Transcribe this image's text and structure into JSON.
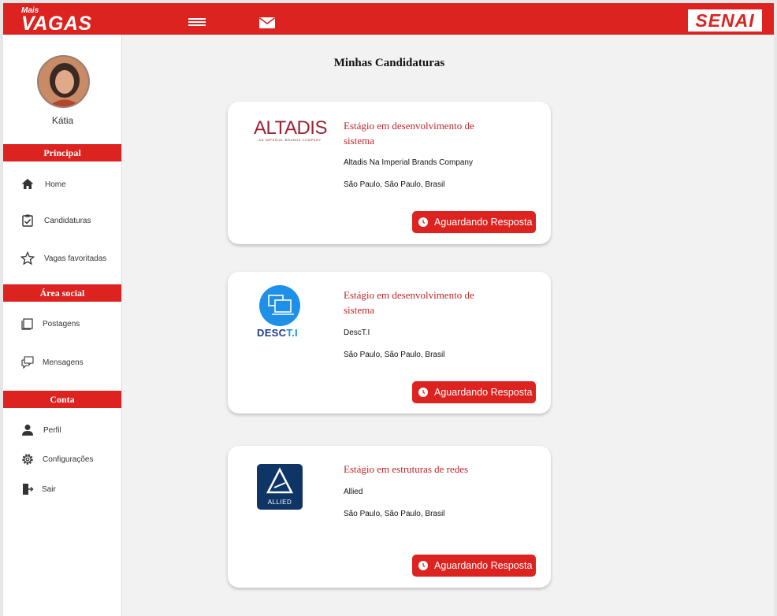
{
  "header": {
    "logo_small": "Mais",
    "logo_big": "VAGAS",
    "brand": "SENAI"
  },
  "user": {
    "name": "Kátia"
  },
  "sidebar": {
    "sections": [
      {
        "title": "Principal"
      },
      {
        "title": "Área social"
      },
      {
        "title": "Conta"
      }
    ],
    "items": [
      {
        "label": "Home",
        "icon": "home-icon"
      },
      {
        "label": "Candidaturas",
        "icon": "clipboard-check-icon"
      },
      {
        "label": "Vagas favoritadas",
        "icon": "star-icon"
      },
      {
        "label": "Postagens",
        "icon": "posts-icon"
      },
      {
        "label": "Mensagens",
        "icon": "chat-icon"
      },
      {
        "label": "Perfil",
        "icon": "person-icon"
      },
      {
        "label": "Configurações",
        "icon": "gear-icon"
      },
      {
        "label": "Sair",
        "icon": "exit-icon"
      }
    ]
  },
  "main": {
    "title": "Minhas Candidaturas",
    "applications": [
      {
        "logo_text": "ALTADIS",
        "logo_subtext": "AN IMPERIAL BRANDS COMPANY",
        "job_title": "Estágio em desenvolvimento de sistema",
        "company": "Altadis Na Imperial Brands Company",
        "location": "São Paulo, São Paulo, Brasil",
        "status": "Aguardando Resposta"
      },
      {
        "logo_text": "DESC",
        "logo_text_accent": "T.I",
        "job_title": "Estágio em desenvolvimento de sistema",
        "company": "DescT.I",
        "location": "São Paulo, São Paulo, Brasil",
        "status": "Aguardando Resposta"
      },
      {
        "logo_text": "ALLIED",
        "job_title": "Estágio em estruturas de redes",
        "company": "Allied",
        "location": "São Paulo, São Paulo, Brasil",
        "status": "Aguardando Resposta"
      }
    ]
  },
  "colors": {
    "accent": "#dd2320",
    "job_title": "#c0262a"
  }
}
